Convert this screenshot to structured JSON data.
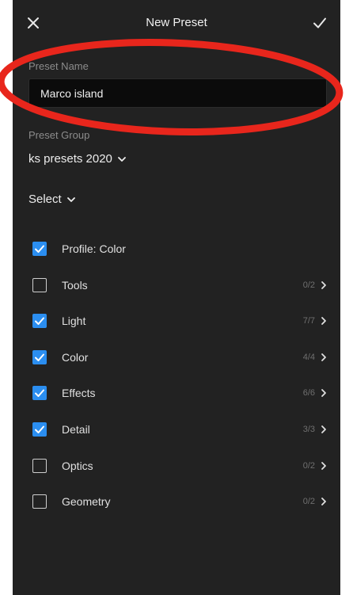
{
  "header": {
    "title": "New Preset",
    "close_icon": "close-icon",
    "confirm_icon": "checkmark-icon"
  },
  "preset_name": {
    "label": "Preset Name",
    "value": "Marco island"
  },
  "preset_group": {
    "label": "Preset Group",
    "value": "ks presets 2020"
  },
  "select": {
    "label": "Select"
  },
  "settings": [
    {
      "label": "Profile: Color",
      "checked": true,
      "count": "",
      "has_arrow": false
    },
    {
      "label": "Tools",
      "checked": false,
      "count": "0/2",
      "has_arrow": true
    },
    {
      "label": "Light",
      "checked": true,
      "count": "7/7",
      "has_arrow": true
    },
    {
      "label": "Color",
      "checked": true,
      "count": "4/4",
      "has_arrow": true
    },
    {
      "label": "Effects",
      "checked": true,
      "count": "6/6",
      "has_arrow": true
    },
    {
      "label": "Detail",
      "checked": true,
      "count": "3/3",
      "has_arrow": true
    },
    {
      "label": "Optics",
      "checked": false,
      "count": "0/2",
      "has_arrow": true
    },
    {
      "label": "Geometry",
      "checked": false,
      "count": "0/2",
      "has_arrow": true
    }
  ],
  "colors": {
    "background": "#222222",
    "checkbox_checked": "#2b8ef0",
    "annotation": "#e8261c"
  }
}
